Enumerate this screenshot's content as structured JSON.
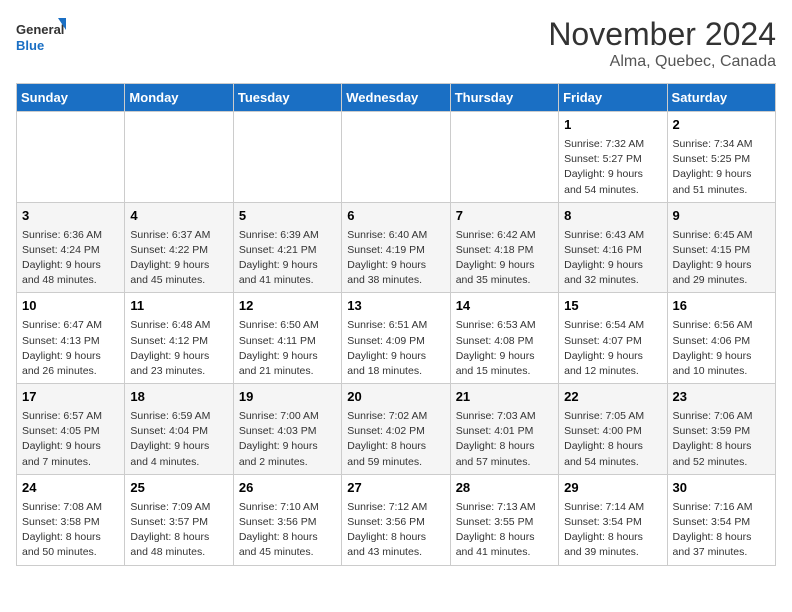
{
  "header": {
    "logo_general": "General",
    "logo_blue": "Blue",
    "month": "November 2024",
    "location": "Alma, Quebec, Canada"
  },
  "days_of_week": [
    "Sunday",
    "Monday",
    "Tuesday",
    "Wednesday",
    "Thursday",
    "Friday",
    "Saturday"
  ],
  "weeks": [
    [
      {
        "day": "",
        "info": ""
      },
      {
        "day": "",
        "info": ""
      },
      {
        "day": "",
        "info": ""
      },
      {
        "day": "",
        "info": ""
      },
      {
        "day": "",
        "info": ""
      },
      {
        "day": "1",
        "info": "Sunrise: 7:32 AM\nSunset: 5:27 PM\nDaylight: 9 hours and 54 minutes."
      },
      {
        "day": "2",
        "info": "Sunrise: 7:34 AM\nSunset: 5:25 PM\nDaylight: 9 hours and 51 minutes."
      }
    ],
    [
      {
        "day": "3",
        "info": "Sunrise: 6:36 AM\nSunset: 4:24 PM\nDaylight: 9 hours and 48 minutes."
      },
      {
        "day": "4",
        "info": "Sunrise: 6:37 AM\nSunset: 4:22 PM\nDaylight: 9 hours and 45 minutes."
      },
      {
        "day": "5",
        "info": "Sunrise: 6:39 AM\nSunset: 4:21 PM\nDaylight: 9 hours and 41 minutes."
      },
      {
        "day": "6",
        "info": "Sunrise: 6:40 AM\nSunset: 4:19 PM\nDaylight: 9 hours and 38 minutes."
      },
      {
        "day": "7",
        "info": "Sunrise: 6:42 AM\nSunset: 4:18 PM\nDaylight: 9 hours and 35 minutes."
      },
      {
        "day": "8",
        "info": "Sunrise: 6:43 AM\nSunset: 4:16 PM\nDaylight: 9 hours and 32 minutes."
      },
      {
        "day": "9",
        "info": "Sunrise: 6:45 AM\nSunset: 4:15 PM\nDaylight: 9 hours and 29 minutes."
      }
    ],
    [
      {
        "day": "10",
        "info": "Sunrise: 6:47 AM\nSunset: 4:13 PM\nDaylight: 9 hours and 26 minutes."
      },
      {
        "day": "11",
        "info": "Sunrise: 6:48 AM\nSunset: 4:12 PM\nDaylight: 9 hours and 23 minutes."
      },
      {
        "day": "12",
        "info": "Sunrise: 6:50 AM\nSunset: 4:11 PM\nDaylight: 9 hours and 21 minutes."
      },
      {
        "day": "13",
        "info": "Sunrise: 6:51 AM\nSunset: 4:09 PM\nDaylight: 9 hours and 18 minutes."
      },
      {
        "day": "14",
        "info": "Sunrise: 6:53 AM\nSunset: 4:08 PM\nDaylight: 9 hours and 15 minutes."
      },
      {
        "day": "15",
        "info": "Sunrise: 6:54 AM\nSunset: 4:07 PM\nDaylight: 9 hours and 12 minutes."
      },
      {
        "day": "16",
        "info": "Sunrise: 6:56 AM\nSunset: 4:06 PM\nDaylight: 9 hours and 10 minutes."
      }
    ],
    [
      {
        "day": "17",
        "info": "Sunrise: 6:57 AM\nSunset: 4:05 PM\nDaylight: 9 hours and 7 minutes."
      },
      {
        "day": "18",
        "info": "Sunrise: 6:59 AM\nSunset: 4:04 PM\nDaylight: 9 hours and 4 minutes."
      },
      {
        "day": "19",
        "info": "Sunrise: 7:00 AM\nSunset: 4:03 PM\nDaylight: 9 hours and 2 minutes."
      },
      {
        "day": "20",
        "info": "Sunrise: 7:02 AM\nSunset: 4:02 PM\nDaylight: 8 hours and 59 minutes."
      },
      {
        "day": "21",
        "info": "Sunrise: 7:03 AM\nSunset: 4:01 PM\nDaylight: 8 hours and 57 minutes."
      },
      {
        "day": "22",
        "info": "Sunrise: 7:05 AM\nSunset: 4:00 PM\nDaylight: 8 hours and 54 minutes."
      },
      {
        "day": "23",
        "info": "Sunrise: 7:06 AM\nSunset: 3:59 PM\nDaylight: 8 hours and 52 minutes."
      }
    ],
    [
      {
        "day": "24",
        "info": "Sunrise: 7:08 AM\nSunset: 3:58 PM\nDaylight: 8 hours and 50 minutes."
      },
      {
        "day": "25",
        "info": "Sunrise: 7:09 AM\nSunset: 3:57 PM\nDaylight: 8 hours and 48 minutes."
      },
      {
        "day": "26",
        "info": "Sunrise: 7:10 AM\nSunset: 3:56 PM\nDaylight: 8 hours and 45 minutes."
      },
      {
        "day": "27",
        "info": "Sunrise: 7:12 AM\nSunset: 3:56 PM\nDaylight: 8 hours and 43 minutes."
      },
      {
        "day": "28",
        "info": "Sunrise: 7:13 AM\nSunset: 3:55 PM\nDaylight: 8 hours and 41 minutes."
      },
      {
        "day": "29",
        "info": "Sunrise: 7:14 AM\nSunset: 3:54 PM\nDaylight: 8 hours and 39 minutes."
      },
      {
        "day": "30",
        "info": "Sunrise: 7:16 AM\nSunset: 3:54 PM\nDaylight: 8 hours and 37 minutes."
      }
    ]
  ]
}
